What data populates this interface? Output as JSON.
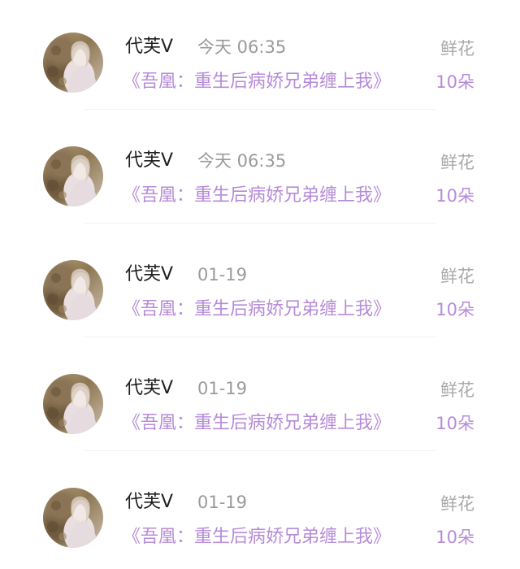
{
  "items": [
    {
      "name": "代芙V",
      "time": "今天 06:35",
      "gift_label": "鲜花",
      "book_title": "《吾凰：重生后病娇兄弟缠上我》",
      "gift_count": "10朵"
    },
    {
      "name": "代芙V",
      "time": "今天 06:35",
      "gift_label": "鲜花",
      "book_title": "《吾凰：重生后病娇兄弟缠上我》",
      "gift_count": "10朵"
    },
    {
      "name": "代芙V",
      "time": "01-19",
      "gift_label": "鲜花",
      "book_title": "《吾凰：重生后病娇兄弟缠上我》",
      "gift_count": "10朵"
    },
    {
      "name": "代芙V",
      "time": "01-19",
      "gift_label": "鲜花",
      "book_title": "《吾凰：重生后病娇兄弟缠上我》",
      "gift_count": "10朵"
    },
    {
      "name": "代芙V",
      "time": "01-19",
      "gift_label": "鲜花",
      "book_title": "《吾凰：重生后病娇兄弟缠上我》",
      "gift_count": "10朵"
    }
  ],
  "colors": {
    "name": "#1f1f1f",
    "time": "#9a9a9a",
    "gift_label": "#a9a9a9",
    "accent": "#b68bd8"
  }
}
